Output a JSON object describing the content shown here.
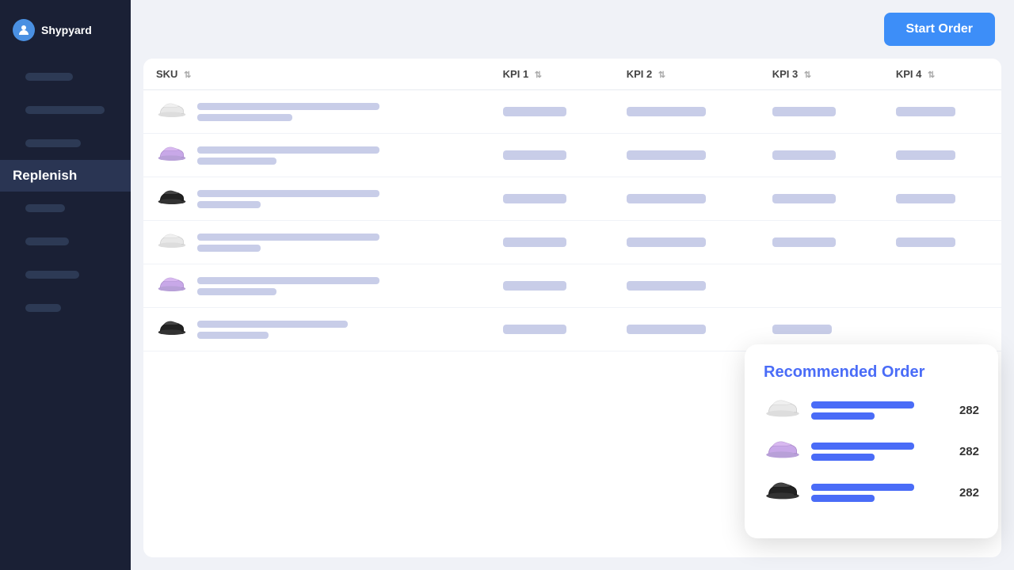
{
  "app": {
    "name": "Shypyard"
  },
  "sidebar": {
    "logo_label": "Shypyard",
    "nav_items": [
      {
        "id": "item1",
        "label": "",
        "active": false
      },
      {
        "id": "item2",
        "label": "",
        "active": false
      },
      {
        "id": "item3",
        "label": "",
        "active": false
      },
      {
        "id": "replenish",
        "label": "Replenish",
        "active": true
      },
      {
        "id": "item5",
        "label": "",
        "active": false
      },
      {
        "id": "item6",
        "label": "",
        "active": false
      },
      {
        "id": "item7",
        "label": "",
        "active": false
      },
      {
        "id": "item8",
        "label": "",
        "active": false
      }
    ]
  },
  "header": {
    "start_order_label": "Start Order"
  },
  "table": {
    "columns": [
      {
        "id": "sku",
        "label": "SKU"
      },
      {
        "id": "kpi1",
        "label": "KPI 1"
      },
      {
        "id": "kpi2",
        "label": "KPI 2"
      },
      {
        "id": "kpi3",
        "label": "KPI 3"
      },
      {
        "id": "kpi4",
        "label": "KPI 4"
      }
    ],
    "rows": [
      {
        "id": "row1",
        "shoe_type": "white",
        "sku_bar1_w": 230,
        "sku_bar2_w": 120,
        "kpi1_w": 80,
        "kpi2_w": 100,
        "kpi3_w": 80,
        "kpi4_w": 75
      },
      {
        "id": "row2",
        "shoe_type": "purple",
        "sku_bar1_w": 230,
        "sku_bar2_w": 100,
        "kpi1_w": 80,
        "kpi2_w": 100,
        "kpi3_w": 80,
        "kpi4_w": 75
      },
      {
        "id": "row3",
        "shoe_type": "black",
        "sku_bar1_w": 230,
        "sku_bar2_w": 80,
        "kpi1_w": 80,
        "kpi2_w": 100,
        "kpi3_w": 80,
        "kpi4_w": 75
      },
      {
        "id": "row4",
        "shoe_type": "white",
        "sku_bar1_w": 230,
        "sku_bar2_w": 80,
        "kpi1_w": 80,
        "kpi2_w": 100,
        "kpi3_w": 80,
        "kpi4_w": 75
      },
      {
        "id": "row5",
        "shoe_type": "purple",
        "sku_bar1_w": 230,
        "sku_bar2_w": 100,
        "kpi1_w": 80,
        "kpi2_w": 100,
        "kpi3_w": 0,
        "kpi4_w": 0
      },
      {
        "id": "row6",
        "shoe_type": "black",
        "sku_bar1_w": 190,
        "sku_bar2_w": 90,
        "kpi1_w": 80,
        "kpi2_w": 100,
        "kpi3_w": 75,
        "kpi4_w": 0
      }
    ]
  },
  "recommended_order": {
    "title": "Recommended Order",
    "items": [
      {
        "shoe_type": "white",
        "bar1_w": 130,
        "bar2_w": 80,
        "count": "282"
      },
      {
        "shoe_type": "purple",
        "bar1_w": 130,
        "bar2_w": 80,
        "count": "282"
      },
      {
        "shoe_type": "black",
        "bar1_w": 130,
        "bar2_w": 80,
        "count": "282"
      }
    ]
  },
  "colors": {
    "accent_blue": "#4a6cf7",
    "btn_blue": "#3d8ef8",
    "sidebar_bg": "#1a2035",
    "skeleton": "#c8cde8",
    "kpi_bar": "#c8cde8"
  }
}
